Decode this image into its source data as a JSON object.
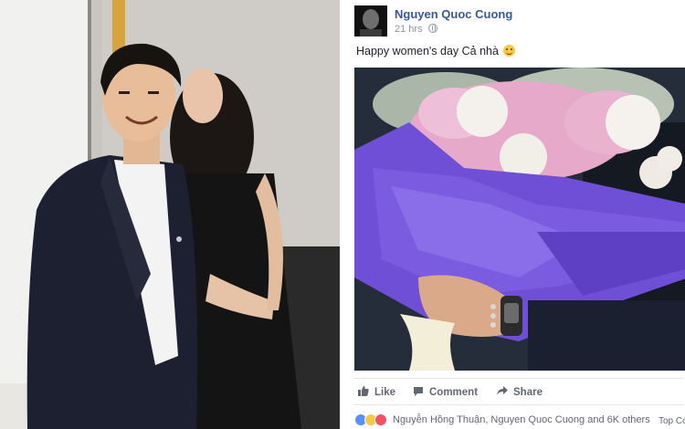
{
  "post": {
    "author": "Nguyen Quoc Cuong",
    "time": "21 hrs",
    "text": "Happy women's day Cả nhà",
    "actions": {
      "like": "Like",
      "comment": "Comment",
      "share": "Share"
    },
    "reactions_text": "Nguyễn Hồng Thuận, Nguyen Quoc Cuong and 6K others",
    "top_comments": "Top Co"
  },
  "icons": {
    "globe": "globe-icon",
    "emoji": "smile-emoji-icon",
    "like": "thumbs-up-icon",
    "comment": "comment-bubble-icon",
    "share": "share-arrow-icon",
    "reactions": [
      "like-reaction-icon",
      "wow-reaction-icon",
      "love-reaction-icon"
    ]
  },
  "colors": {
    "author_link": "#365899",
    "meta_gray": "#90949c",
    "action_gray": "#616770",
    "wrapping_purple": "#6f4fd6"
  }
}
